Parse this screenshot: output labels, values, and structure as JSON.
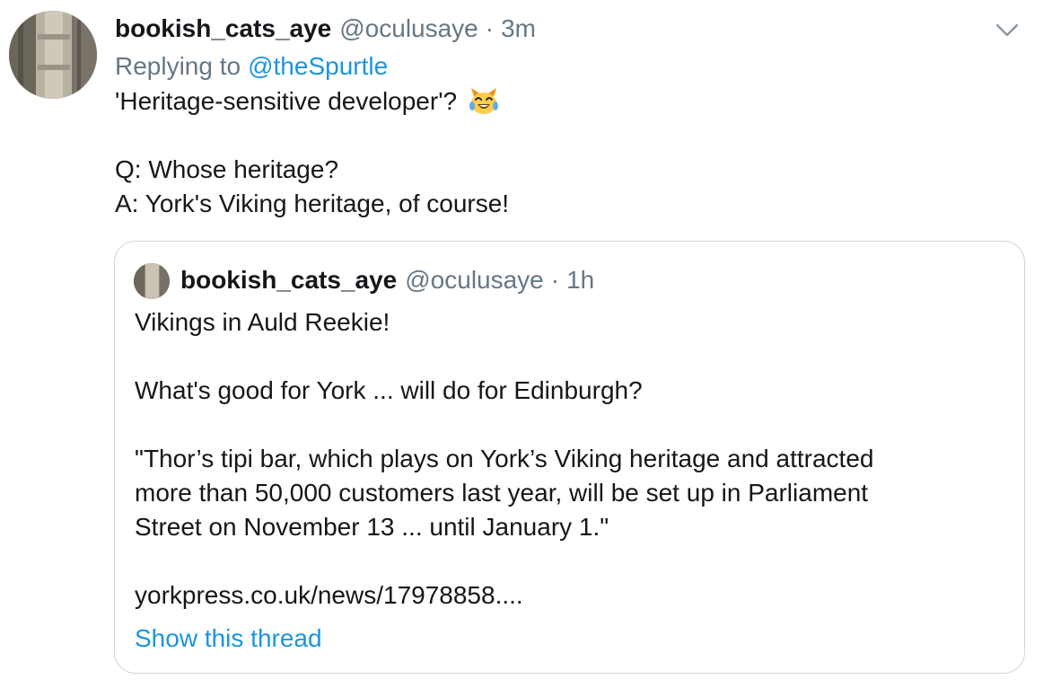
{
  "tweet": {
    "author_name": "bookish_cats_aye",
    "handle": "@oculusaye",
    "separator": "·",
    "time": "3m",
    "replying_prefix": "Replying to",
    "replying_to": "@theSpurtle",
    "line1": "'Heritage-sensitive developer'?",
    "emoji": "laughing-cat-face-with-tears-of-joy",
    "line2": "Q: Whose heritage?",
    "line3": "A: York's Viking heritage, of course!",
    "menu_icon": "chevron-down-icon"
  },
  "quoted": {
    "author_name": "bookish_cats_aye",
    "handle": "@oculusaye",
    "separator": "·",
    "time": "1h",
    "line1": "Vikings in Auld Reekie!",
    "line2": "What's good for York ... will do for Edinburgh?",
    "line3": "\"Thor’s tipi bar, which plays on York’s Viking heritage and attracted",
    "line4": "more than 50,000 customers last year, will be set up in Parliament",
    "line5": "Street on November 13 ... until January 1.\"",
    "link": "yorkpress.co.uk/news/17978858....",
    "show_thread": "Show this thread"
  },
  "colors": {
    "text": "#14171a",
    "secondary": "#657786",
    "link": "#1b95e0",
    "border": "#ccd6dd"
  }
}
